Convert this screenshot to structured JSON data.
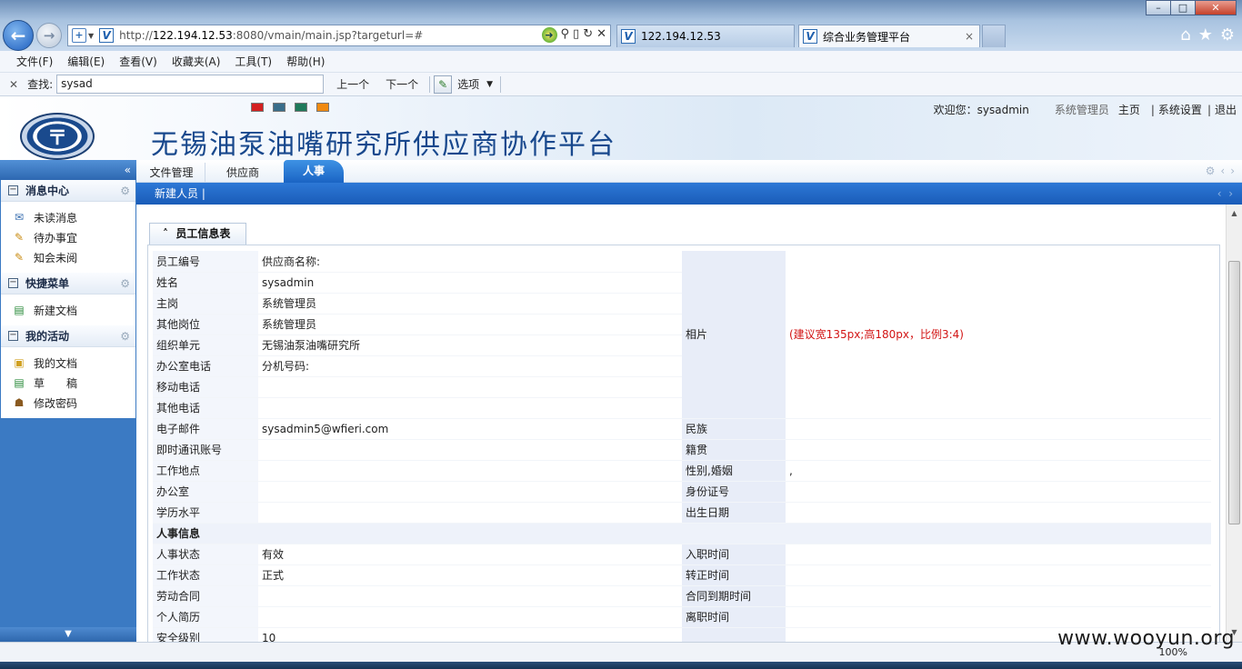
{
  "browser": {
    "url_prefix": "http://",
    "url_host": "122.194.12.53",
    "url_rest": ":8080/vmain/main.jsp?targeturl=#",
    "tabs": [
      {
        "label": "122.194.12.53"
      },
      {
        "label": "综合业务管理平台",
        "close": "×"
      }
    ],
    "window_controls": {
      "minimize": "–",
      "maximize": "□",
      "close": "✕"
    },
    "menu": [
      "文件(F)",
      "编辑(E)",
      "查看(V)",
      "收藏夹(A)",
      "工具(T)",
      "帮助(H)"
    ],
    "find": {
      "close": "✕",
      "label": "查找:",
      "value": "sysad",
      "prev": "上一个",
      "next": "下一个",
      "options": "选项"
    },
    "zoom": "100%"
  },
  "app": {
    "title": "无锡油泵油嘴研究所供应商协作平台",
    "welcome": "欢迎您：sysadmin",
    "role": "系统管理员",
    "home": "主页",
    "settings": "系统设置",
    "logout": "退出",
    "sep": "|",
    "skin_colors": [
      "#d42020",
      "#3a6e8a",
      "#1f7a5a",
      "#f08a10"
    ]
  },
  "sidebar": {
    "collapse": "«",
    "sections": [
      {
        "title": "消息中心",
        "items": [
          {
            "icon": "mail-icon",
            "glyph": "✉",
            "label": "未读消息"
          },
          {
            "icon": "edit-icon",
            "glyph": "✎",
            "label": "待办事宜"
          },
          {
            "icon": "edit-icon",
            "glyph": "✎",
            "label": "知会未阅"
          }
        ]
      },
      {
        "title": "快捷菜单",
        "items": [
          {
            "icon": "new-doc-icon",
            "glyph": "▤",
            "label": "新建文档"
          }
        ]
      },
      {
        "title": "我的活动",
        "items": [
          {
            "icon": "folder-icon",
            "glyph": "▣",
            "label": "我的文档"
          },
          {
            "icon": "draft-icon",
            "glyph": "▤",
            "label": "草　　稿"
          },
          {
            "icon": "user-key-icon",
            "glyph": "☗",
            "label": "修改密码"
          }
        ]
      }
    ]
  },
  "main_tabs": [
    "文件管理",
    "供应商",
    "人事"
  ],
  "breadcrumb": "新建人员  |",
  "form": {
    "section_title": "员工信息表",
    "rows": [
      {
        "label": "员工编号",
        "value": " 供应商名称:"
      },
      {
        "label": "姓名",
        "value": "sysadmin"
      },
      {
        "label": "主岗",
        "value": " 系统管理员"
      },
      {
        "label": "其他岗位",
        "value": " 系统管理员"
      },
      {
        "label": "组织单元",
        "value": " 无锡油泵油嘴研究所"
      },
      {
        "label": "办公室电话",
        "value": " 分机号码:"
      },
      {
        "label": "移动电话",
        "value": ""
      },
      {
        "label": "其他电话",
        "value": ""
      }
    ],
    "photo_label": "相片",
    "photo_hint": "(建议宽135px;高180px，比例3:4)",
    "rows2": [
      {
        "label": "电子邮件",
        "value": "sysadmin5@wfieri.com",
        "label2": "民族",
        "value2": ""
      },
      {
        "label": "即时通讯账号",
        "value": "",
        "label2": "籍贯",
        "value2": ""
      },
      {
        "label": "工作地点",
        "value": "",
        "label2": "性别,婚姻",
        "value2": ","
      },
      {
        "label": "办公室",
        "value": "",
        "label2": "身份证号",
        "value2": ""
      },
      {
        "label": "学历水平",
        "value": "",
        "label2": "出生日期",
        "value2": ""
      }
    ],
    "hr_section": "人事信息",
    "rows3": [
      {
        "label": "人事状态",
        "value": "有效",
        "label2": "入职时间",
        "value2": ""
      },
      {
        "label": "工作状态",
        "value": "正式",
        "label2": "转正时间",
        "value2": ""
      },
      {
        "label": "劳动合同",
        "value": "",
        "label2": "合同到期时间",
        "value2": ""
      },
      {
        "label": "个人简历",
        "value": "",
        "label2": "离职时间",
        "value2": ""
      },
      {
        "label": "安全级别",
        "value": "10",
        "label2": "",
        "value2": ""
      }
    ]
  },
  "watermark": "www.wooyun.org"
}
